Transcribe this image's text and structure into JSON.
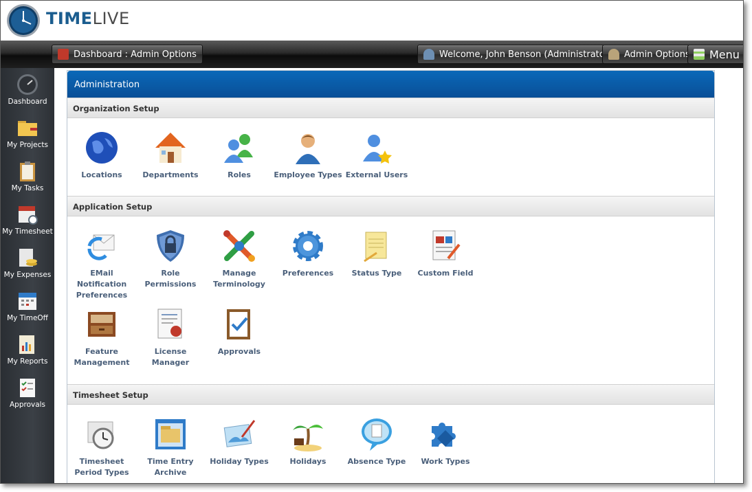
{
  "app": {
    "logo_time": "TIME",
    "logo_live": "LIVE"
  },
  "topbar": {
    "dashboard_label": "Dashboard : Admin Options",
    "welcome_label": "Welcome, John Benson (Administrator)",
    "admin_options_label": "Admin Options",
    "menu_label": "Menu"
  },
  "sidebar": {
    "items": [
      {
        "label": "Dashboard",
        "icon": "dashboard-icon"
      },
      {
        "label": "My Projects",
        "icon": "folder-icon"
      },
      {
        "label": "My Tasks",
        "icon": "clipboard-icon"
      },
      {
        "label": "My Timesheet",
        "icon": "calendar-clock-icon"
      },
      {
        "label": "My Expenses",
        "icon": "coins-icon"
      },
      {
        "label": "My TimeOff",
        "icon": "calendar-icon"
      },
      {
        "label": "My Reports",
        "icon": "report-icon"
      },
      {
        "label": "Approvals",
        "icon": "checklist-icon"
      }
    ]
  },
  "panel": {
    "title": "Administration",
    "sections": {
      "organization": {
        "title": "Organization Setup",
        "items": [
          {
            "label": "Locations",
            "icon": "globe-icon"
          },
          {
            "label": "Departments",
            "icon": "house-icon"
          },
          {
            "label": "Roles",
            "icon": "users-icon"
          },
          {
            "label": "Employee Types",
            "icon": "person-icon"
          },
          {
            "label": "External Users",
            "icon": "user-star-icon"
          }
        ]
      },
      "application": {
        "title": "Application Setup",
        "items": [
          {
            "label": "EMail Notification Preferences",
            "icon": "email-icon"
          },
          {
            "label": "Role Permissions",
            "icon": "shield-lock-icon"
          },
          {
            "label": "Manage Terminology",
            "icon": "puzzle-icon"
          },
          {
            "label": "Preferences",
            "icon": "gear-icon"
          },
          {
            "label": "Status Type",
            "icon": "notepad-icon"
          },
          {
            "label": "Custom Field",
            "icon": "chart-doc-icon"
          },
          {
            "label": "Feature Management",
            "icon": "drawer-icon"
          },
          {
            "label": "License Manager",
            "icon": "certificate-icon"
          },
          {
            "label": "Approvals",
            "icon": "checkbox-clipboard-icon"
          }
        ]
      },
      "timesheet": {
        "title": "Timesheet Setup",
        "items": [
          {
            "label": "Timesheet Period Types",
            "icon": "clock-calendar-icon"
          },
          {
            "label": "Time Entry Archive",
            "icon": "archive-icon"
          },
          {
            "label": "Holiday Types",
            "icon": "painting-icon"
          },
          {
            "label": "Holidays",
            "icon": "palm-tree-icon"
          },
          {
            "label": "Absence Type",
            "icon": "speech-bubble-icon"
          },
          {
            "label": "Work Types",
            "icon": "puzzle-blue-icon"
          }
        ]
      }
    }
  }
}
